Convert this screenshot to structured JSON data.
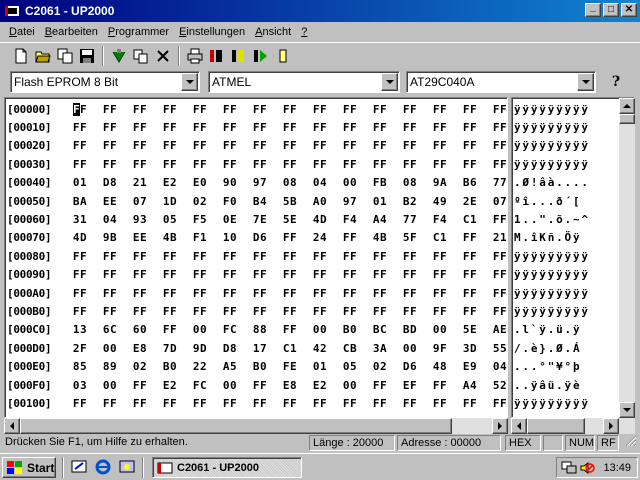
{
  "window": {
    "title": "C2061 - UP2000",
    "minimize_label": "_",
    "maximize_label": "□",
    "close_label": "✕"
  },
  "menu": [
    {
      "label": "Datei",
      "accel": "D",
      "rest": "atei"
    },
    {
      "label": "Bearbeiten",
      "accel": "B",
      "rest": "earbeiten"
    },
    {
      "label": "Programmer",
      "accel": "P",
      "rest": "rogrammer"
    },
    {
      "label": "Einstellungen",
      "accel": "E",
      "rest": "instellungen"
    },
    {
      "label": "Ansicht",
      "accel": "A",
      "rest": "nsicht"
    },
    {
      "label": "?",
      "accel": "?",
      "rest": ""
    }
  ],
  "toolbar": {
    "icons": [
      "new-file-icon",
      "open-folder-icon",
      "copy-files-icon",
      "save-disk-icon",
      "erase-icon",
      "copy-icon",
      "delete-icon",
      "print-icon",
      "read-chip-icon",
      "verify-chip-icon",
      "program-chip-icon",
      "blank-check-icon"
    ]
  },
  "selectors": {
    "type": "Flash EPROM 8 Bit",
    "manufacturer": "ATMEL",
    "device": "AT29C040A",
    "help_label": "?"
  },
  "hex": {
    "rows": [
      {
        "addr": "[00000]",
        "bytes": [
          "FF",
          "FF",
          "FF",
          "FF",
          "FF",
          "FF",
          "FF",
          "FF",
          "FF",
          "FF",
          "FF",
          "FF",
          "FF",
          "FF",
          "FF"
        ],
        "ascii": "ÿÿÿÿÿÿÿÿÿ"
      },
      {
        "addr": "[00010]",
        "bytes": [
          "FF",
          "FF",
          "FF",
          "FF",
          "FF",
          "FF",
          "FF",
          "FF",
          "FF",
          "FF",
          "FF",
          "FF",
          "FF",
          "FF",
          "FF"
        ],
        "ascii": "ÿÿÿÿÿÿÿÿÿ"
      },
      {
        "addr": "[00020]",
        "bytes": [
          "FF",
          "FF",
          "FF",
          "FF",
          "FF",
          "FF",
          "FF",
          "FF",
          "FF",
          "FF",
          "FF",
          "FF",
          "FF",
          "FF",
          "FF"
        ],
        "ascii": "ÿÿÿÿÿÿÿÿÿ"
      },
      {
        "addr": "[00030]",
        "bytes": [
          "FF",
          "FF",
          "FF",
          "FF",
          "FF",
          "FF",
          "FF",
          "FF",
          "FF",
          "FF",
          "FF",
          "FF",
          "FF",
          "FF",
          "FF"
        ],
        "ascii": "ÿÿÿÿÿÿÿÿÿ"
      },
      {
        "addr": "[00040]",
        "bytes": [
          "01",
          "D8",
          "21",
          "E2",
          "E0",
          "90",
          "97",
          "08",
          "04",
          "00",
          "FB",
          "08",
          "9A",
          "B6",
          "77"
        ],
        "ascii": ".Ø!âà...."
      },
      {
        "addr": "[00050]",
        "bytes": [
          "BA",
          "EE",
          "07",
          "1D",
          "02",
          "F0",
          "B4",
          "5B",
          "A0",
          "97",
          "01",
          "B2",
          "49",
          "2E",
          "07"
        ],
        "ascii": "ºî...ð´["
      },
      {
        "addr": "[00060]",
        "bytes": [
          "31",
          "04",
          "93",
          "05",
          "F5",
          "0E",
          "7E",
          "5E",
          "4D",
          "F4",
          "A4",
          "77",
          "F4",
          "C1",
          "FF"
        ],
        "ascii": "1..\".õ.~^"
      },
      {
        "addr": "[00070]",
        "bytes": [
          "4D",
          "9B",
          "EE",
          "4B",
          "F1",
          "10",
          "D6",
          "FF",
          "24",
          "FF",
          "4B",
          "5F",
          "C1",
          "FF",
          "21"
        ],
        "ascii": "M.îKñ.Öÿ"
      },
      {
        "addr": "[00080]",
        "bytes": [
          "FF",
          "FF",
          "FF",
          "FF",
          "FF",
          "FF",
          "FF",
          "FF",
          "FF",
          "FF",
          "FF",
          "FF",
          "FF",
          "FF",
          "FF"
        ],
        "ascii": "ÿÿÿÿÿÿÿÿÿ"
      },
      {
        "addr": "[00090]",
        "bytes": [
          "FF",
          "FF",
          "FF",
          "FF",
          "FF",
          "FF",
          "FF",
          "FF",
          "FF",
          "FF",
          "FF",
          "FF",
          "FF",
          "FF",
          "FF"
        ],
        "ascii": "ÿÿÿÿÿÿÿÿÿ"
      },
      {
        "addr": "[000A0]",
        "bytes": [
          "FF",
          "FF",
          "FF",
          "FF",
          "FF",
          "FF",
          "FF",
          "FF",
          "FF",
          "FF",
          "FF",
          "FF",
          "FF",
          "FF",
          "FF"
        ],
        "ascii": "ÿÿÿÿÿÿÿÿÿ"
      },
      {
        "addr": "[000B0]",
        "bytes": [
          "FF",
          "FF",
          "FF",
          "FF",
          "FF",
          "FF",
          "FF",
          "FF",
          "FF",
          "FF",
          "FF",
          "FF",
          "FF",
          "FF",
          "FF"
        ],
        "ascii": "ÿÿÿÿÿÿÿÿÿ"
      },
      {
        "addr": "[000C0]",
        "bytes": [
          "13",
          "6C",
          "60",
          "FF",
          "00",
          "FC",
          "88",
          "FF",
          "00",
          "B0",
          "BC",
          "BD",
          "00",
          "5E",
          "AE"
        ],
        "ascii": ".l`ÿ.ü.ÿ"
      },
      {
        "addr": "[000D0]",
        "bytes": [
          "2F",
          "00",
          "E8",
          "7D",
          "9D",
          "D8",
          "17",
          "C1",
          "42",
          "CB",
          "3A",
          "00",
          "9F",
          "3D",
          "55"
        ],
        "ascii": "/.è}.Ø.Á"
      },
      {
        "addr": "[000E0]",
        "bytes": [
          "85",
          "89",
          "02",
          "B0",
          "22",
          "A5",
          "B0",
          "FE",
          "01",
          "05",
          "02",
          "D6",
          "48",
          "E9",
          "04"
        ],
        "ascii": "...°\"¥°þ"
      },
      {
        "addr": "[000F0]",
        "bytes": [
          "03",
          "00",
          "FF",
          "E2",
          "FC",
          "00",
          "FF",
          "E8",
          "E2",
          "00",
          "FF",
          "EF",
          "FF",
          "A4",
          "52"
        ],
        "ascii": "..ÿâü.ÿè"
      },
      {
        "addr": "[00100]",
        "bytes": [
          "FF",
          "FF",
          "FF",
          "FF",
          "FF",
          "FF",
          "FF",
          "FF",
          "FF",
          "FF",
          "FF",
          "FF",
          "FF",
          "FF",
          "FF"
        ],
        "ascii": "ÿÿÿÿÿÿÿÿÿ"
      }
    ]
  },
  "status": {
    "help": "Drücken Sie F1, um Hilfe zu erhalten.",
    "length": "Länge : 20000",
    "address": "Adresse : 00000",
    "mode": "HEX",
    "num": "NUM",
    "rf": "RF"
  },
  "taskbar": {
    "start_label": "Start",
    "task_label": "C2061 - UP2000",
    "clock": "13:49"
  }
}
